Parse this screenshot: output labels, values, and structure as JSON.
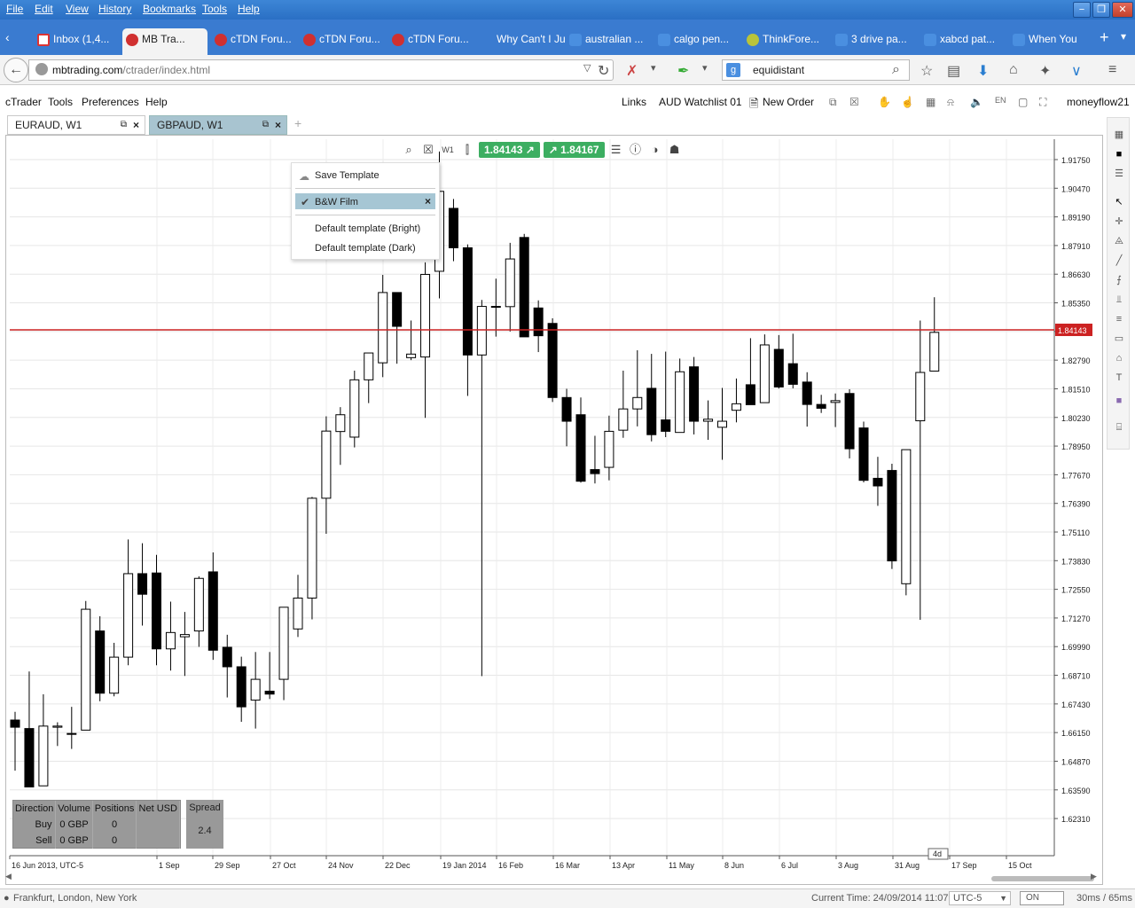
{
  "browser_menu": [
    "File",
    "Edit",
    "View",
    "History",
    "Bookmarks",
    "Tools",
    "Help"
  ],
  "browser_tabs": [
    {
      "label": "Inbox (1,4...",
      "icon": "gmail-icon",
      "fav": "m"
    },
    {
      "label": "MB Tra...",
      "icon": "ctrader-icon",
      "fav": "r",
      "active": true
    },
    {
      "label": "cTDN Foru...",
      "icon": "ctrader-icon",
      "fav": "r"
    },
    {
      "label": "cTDN Foru...",
      "icon": "ctrader-icon",
      "fav": "r"
    },
    {
      "label": "cTDN Foru...",
      "icon": "ctrader-icon",
      "fav": "r"
    },
    {
      "label": "Why Can't I Ju...",
      "icon": "page-icon",
      "fav": "n"
    },
    {
      "label": "australian ...",
      "icon": "google-icon",
      "fav": "g"
    },
    {
      "label": "calgo pen...",
      "icon": "google-icon",
      "fav": "g"
    },
    {
      "label": "ThinkFore...",
      "icon": "thinkforex-icon",
      "fav": "t"
    },
    {
      "label": "3 drive pa...",
      "icon": "google-icon",
      "fav": "g"
    },
    {
      "label": "xabcd pat...",
      "icon": "google-icon",
      "fav": "g"
    },
    {
      "label": "When You",
      "icon": "page-icon",
      "fav": "g"
    }
  ],
  "url": {
    "host": "mbtrading.com",
    "path": "/ctrader/index.html"
  },
  "search": {
    "value": "equidistant"
  },
  "app_menu": [
    "cTrader",
    "Tools",
    "Preferences",
    "Help"
  ],
  "app_links": {
    "links": "Links",
    "watchlist": "AUD Watchlist 01",
    "new_order": "New Order",
    "user": "moneyflow21"
  },
  "chart_tabs": [
    {
      "label": "EURAUD, W1"
    },
    {
      "label": "GBPAUD, W1"
    }
  ],
  "toolbar": {
    "timeframe": "W1",
    "bid": "1.84143",
    "ask": "1.84167"
  },
  "template_menu": {
    "save": "Save Template",
    "selected": "B&W Film",
    "opt1": "Default template (Bright)",
    "opt2": "Default template (Dark)"
  },
  "trade_panel": {
    "headers": [
      "Direction",
      "Volume",
      "Positions",
      "Net USD"
    ],
    "rows": [
      [
        "Buy",
        "0 GBP",
        "0",
        ""
      ],
      [
        "Sell",
        "0 GBP",
        "0",
        ""
      ]
    ],
    "spread_label": "Spread",
    "spread": "2.4"
  },
  "chart_data": {
    "type": "candlestick",
    "current_price": "1.84143",
    "current_price_num": 1.84143,
    "ylim": [
      1.6065,
      1.9266
    ],
    "y_ticks": [
      "1.91750",
      "1.90470",
      "1.89190",
      "1.87910",
      "1.86630",
      "1.85350",
      "1.84070",
      "1.82790",
      "1.81510",
      "1.80230",
      "1.78950",
      "1.77670",
      "1.76390",
      "1.75110",
      "1.73830",
      "1.72550",
      "1.71270",
      "1.69990",
      "1.68710",
      "1.67430",
      "1.66150",
      "1.64870",
      "1.63590",
      "1.62310"
    ],
    "x_labels": [
      "16 Jun 2013, UTC-5",
      "1 Sep",
      "29 Sep",
      "27 Oct",
      "24 Nov",
      "22 Dec",
      "19 Jan 2014",
      "16 Feb",
      "16 Mar",
      "13 Apr",
      "11 May",
      "8 Jun",
      "6 Jul",
      "3 Aug",
      "31 Aug",
      "17 Sep",
      "15 Oct"
    ],
    "marker": "4d",
    "candles": [
      [
        1.6671,
        1.6708,
        1.6445,
        1.6639
      ],
      [
        1.6633,
        1.6888,
        1.6386,
        1.6372
      ],
      [
        1.6377,
        1.6786,
        1.6383,
        1.6644
      ],
      [
        1.6639,
        1.6661,
        1.6555,
        1.6644
      ],
      [
        1.6607,
        1.673,
        1.6542,
        1.6611
      ],
      [
        1.6626,
        1.7203,
        1.6658,
        1.7166
      ],
      [
        1.7069,
        1.7135,
        1.6755,
        1.6791
      ],
      [
        1.6791,
        1.7016,
        1.6777,
        1.6952
      ],
      [
        1.6952,
        1.7478,
        1.6916,
        1.7325
      ],
      [
        1.7325,
        1.7461,
        1.7093,
        1.7233
      ],
      [
        1.7328,
        1.7409,
        1.6916,
        1.6989
      ],
      [
        1.6989,
        1.72,
        1.6892,
        1.7062
      ],
      [
        1.7043,
        1.7154,
        1.6868,
        1.7053
      ],
      [
        1.7069,
        1.7313,
        1.6998,
        1.7304
      ],
      [
        1.7333,
        1.742,
        1.694,
        1.6983
      ],
      [
        1.6996,
        1.7052,
        1.6772,
        1.6909
      ],
      [
        1.6909,
        1.6954,
        1.6663,
        1.673
      ],
      [
        1.676,
        1.6975,
        1.6633,
        1.6853
      ],
      [
        1.68,
        1.6975,
        1.6765,
        1.6787
      ],
      [
        1.6853,
        1.7136,
        1.676,
        1.7175
      ],
      [
        1.7078,
        1.732,
        1.7042,
        1.7216
      ],
      [
        1.7216,
        1.7668,
        1.7121,
        1.7662
      ],
      [
        1.7662,
        1.8028,
        1.7503,
        1.7962
      ],
      [
        1.796,
        1.8069,
        1.7811,
        1.8035
      ],
      [
        1.7935,
        1.8232,
        1.7889,
        1.8191
      ],
      [
        1.8191,
        1.8288,
        1.8087,
        1.8311
      ],
      [
        1.8267,
        1.866,
        1.8203,
        1.8581
      ],
      [
        1.8581,
        1.8538,
        1.8263,
        1.843
      ],
      [
        1.829,
        1.8456,
        1.8279,
        1.8306
      ],
      [
        1.8293,
        1.8716,
        1.8021,
        1.8662
      ],
      [
        1.8676,
        1.9211,
        1.8555,
        1.9033
      ],
      [
        1.8957,
        1.8999,
        1.8721,
        1.8781
      ],
      [
        1.8781,
        1.8796,
        1.8119,
        1.8302
      ],
      [
        1.8302,
        1.8548,
        1.6867,
        1.8519
      ],
      [
        1.8519,
        1.8643,
        1.8384,
        1.8518
      ],
      [
        1.8518,
        1.8803,
        1.8407,
        1.8731
      ],
      [
        1.8827,
        1.8843,
        1.8399,
        1.8383
      ],
      [
        1.8512,
        1.8546,
        1.8315,
        1.8388
      ],
      [
        1.8443,
        1.8466,
        1.8092,
        1.8112
      ],
      [
        1.8112,
        1.8151,
        1.7894,
        1.8006
      ],
      [
        1.8035,
        1.8112,
        1.7732,
        1.7738
      ],
      [
        1.779,
        1.7941,
        1.7728,
        1.7772
      ],
      [
        1.78,
        1.8031,
        1.7742,
        1.7961
      ],
      [
        1.7966,
        1.8232,
        1.7932,
        1.8061
      ],
      [
        1.8061,
        1.8323,
        1.7983,
        1.8112
      ],
      [
        1.8153,
        1.8307,
        1.7916,
        1.7946
      ],
      [
        1.8012,
        1.8317,
        1.7935,
        1.7961
      ],
      [
        1.7956,
        1.8286,
        1.8103,
        1.8227
      ],
      [
        1.8249,
        1.8293,
        1.7947,
        1.8006
      ],
      [
        1.8006,
        1.8099,
        1.7923,
        1.8015
      ],
      [
        1.7979,
        1.8155,
        1.7834,
        1.8006
      ],
      [
        1.8055,
        1.8197,
        1.8001,
        1.8084
      ],
      [
        1.8169,
        1.8377,
        1.8109,
        1.808
      ],
      [
        1.8089,
        1.8394,
        1.8099,
        1.8347
      ],
      [
        1.8327,
        1.8391,
        1.8152,
        1.8159
      ],
      [
        1.8263,
        1.8397,
        1.8153,
        1.8171
      ],
      [
        1.8181,
        1.8225,
        1.7982,
        1.8081
      ],
      [
        1.8081,
        1.8124,
        1.8043,
        1.8064
      ],
      [
        1.809,
        1.813,
        1.798,
        1.8098
      ],
      [
        1.813,
        1.8149,
        1.784,
        1.7883
      ],
      [
        1.7976,
        1.8004,
        1.7733,
        1.7742
      ],
      [
        1.7751,
        1.7847,
        1.7628,
        1.7717
      ],
      [
        1.7786,
        1.7816,
        1.7346,
        1.7382
      ],
      [
        1.728,
        1.7838,
        1.7228,
        1.7879
      ],
      [
        1.8008,
        1.8456,
        1.7119,
        1.8224
      ],
      [
        1.823,
        1.856,
        1.825,
        1.8403
      ]
    ]
  }
}
